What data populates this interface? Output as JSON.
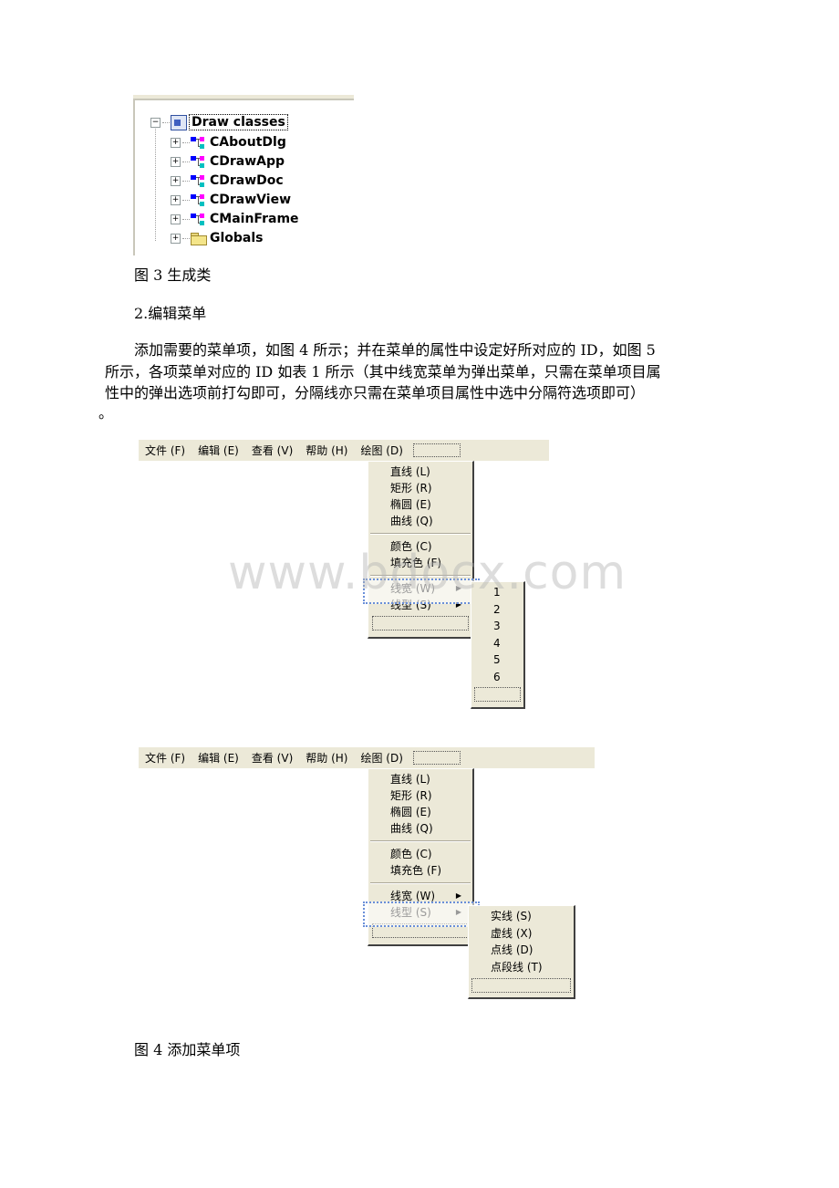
{
  "figure3": {
    "tree": {
      "root": "Draw classes",
      "items": [
        {
          "label": "CAboutDlg",
          "icon": "class-icon"
        },
        {
          "label": "CDrawApp",
          "icon": "class-icon"
        },
        {
          "label": "CDrawDoc",
          "icon": "class-icon"
        },
        {
          "label": "CDrawView",
          "icon": "class-icon"
        },
        {
          "label": "CMainFrame",
          "icon": "class-icon"
        },
        {
          "label": "Globals",
          "icon": "folder-icon"
        }
      ],
      "collapse_glyph": "−",
      "expand_glyph": "+"
    },
    "caption": "图 3 生成类"
  },
  "section_heading": "2.编辑菜单",
  "paragraph": {
    "line1": "添加需要的菜单项，如图 4 所示；并在菜单的属性中设定好所对应的 ID，如图 5",
    "line2": "所示，各项菜单对应的 ID 如表 1 所示（其中线宽菜单为弹出菜单，只需在菜单项目属",
    "line3": "性中的弹出选项前打勾即可，分隔线亦只需在菜单项目属性中选中分隔符选项即可）",
    "line4": "。"
  },
  "menubar": {
    "items": [
      "文件 (F)",
      "编辑 (E)",
      "查看 (V)",
      "帮助 (H)",
      "绘图 (D)"
    ]
  },
  "draw_menu": {
    "group1": [
      "直线 (L)",
      "矩形 (R)",
      "椭圆 (E)",
      "曲线 (Q)"
    ],
    "group2": [
      "颜色 (C)",
      "填充色 (F)"
    ],
    "group3": [
      "线宽 (W)",
      "线型 (S)"
    ],
    "submenu_arrow": "▶"
  },
  "linewidth_submenu": {
    "items": [
      "1",
      "2",
      "3",
      "4",
      "5",
      "6"
    ]
  },
  "linestyle_submenu": {
    "items": [
      "实线 (S)",
      "虚线 (X)",
      "点线 (D)",
      "点段线 (T)"
    ]
  },
  "watermark": "www.bdocx.com",
  "figure4": {
    "caption": "图 4 添加菜单项"
  }
}
